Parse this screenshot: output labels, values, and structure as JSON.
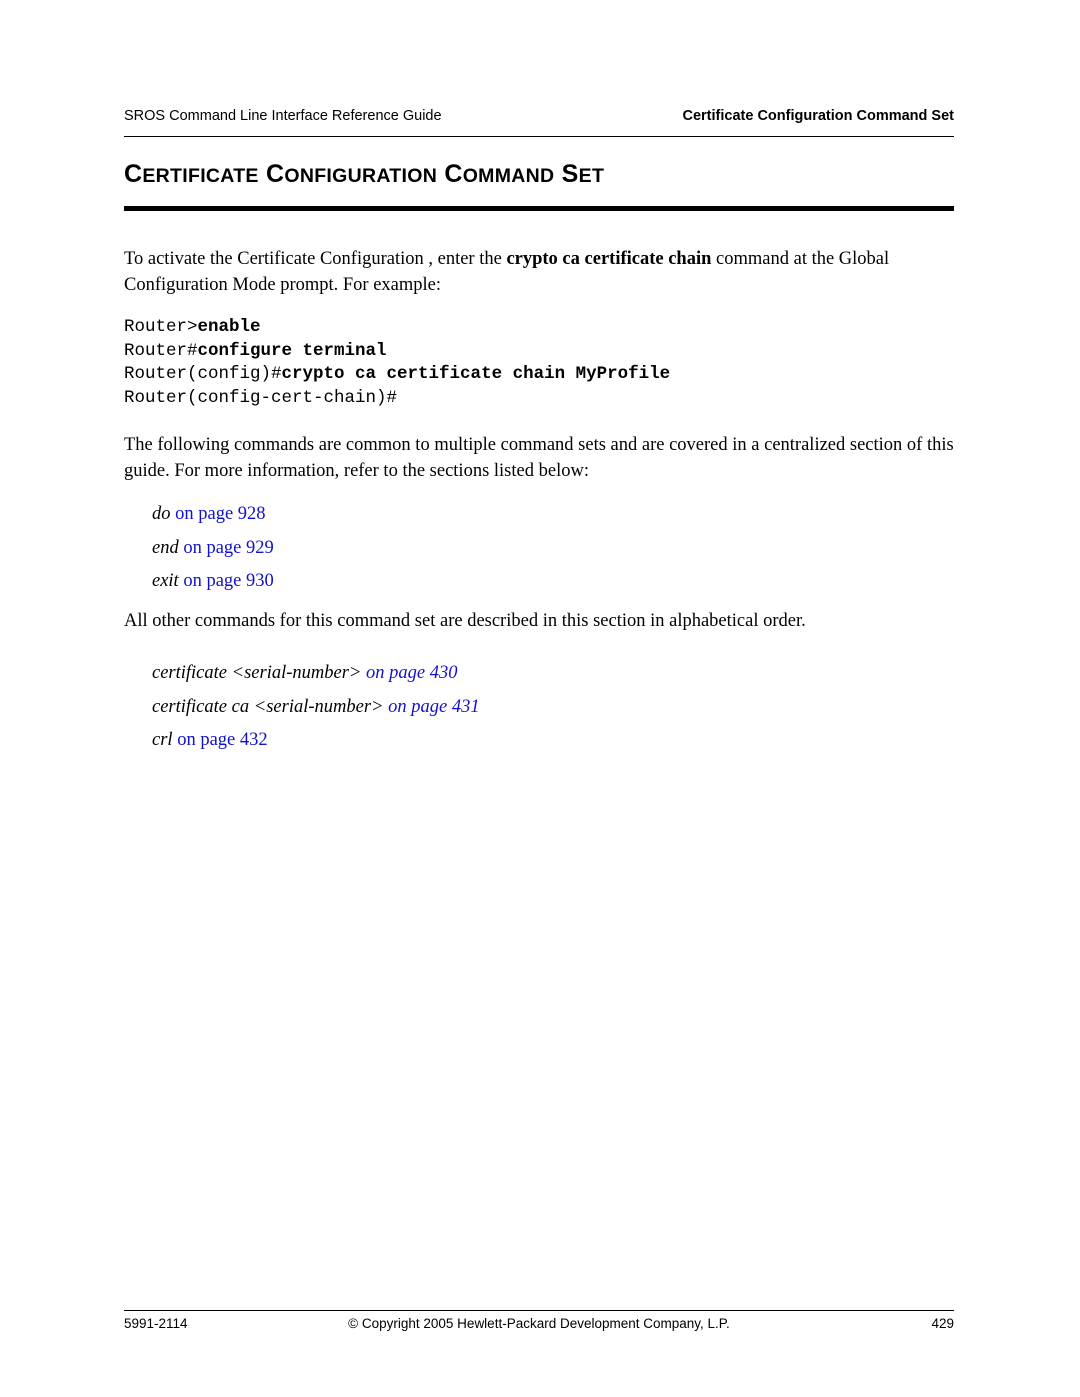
{
  "header": {
    "left": "SROS Command Line Interface Reference Guide",
    "right": "Certificate Configuration Command Set"
  },
  "title": {
    "first_cap": "C",
    "rest_1": "ERTIFICATE",
    "second_cap": "C",
    "rest_2": "ONFIGURATION",
    "third_cap": "C",
    "rest_3": "OMMAND",
    "fourth_cap": "S",
    "rest_4": "ET",
    "plain": "CERTIFICATE CONFIGURATION COMMAND SET"
  },
  "paragraphs": {
    "intro_part1": "To activate the Certificate Configuration , enter the ",
    "intro_bold": "crypto ca certificate chain",
    "intro_part2": " command at the Global Configuration Mode prompt. For example:",
    "common_text": "The following commands are common to multiple command sets and are covered in a centralized section of this guide. For more information, refer to the sections listed below:",
    "alpha_text": "All other commands for this command set are described in this section in alphabetical order."
  },
  "code": {
    "line1_prompt": "Router>",
    "line1_cmd": "enable",
    "line2_prompt": "Router#",
    "line2_cmd": "configure terminal",
    "line3_prompt": "Router(config)#",
    "line3_cmd": "crypto ca certificate chain MyProfile",
    "line4_prompt": "Router(config-cert-chain)#"
  },
  "xrefs_common": [
    {
      "cmd": "do",
      "link": "on page 928"
    },
    {
      "cmd": "end",
      "link": "on page 929"
    },
    {
      "cmd": "exit",
      "link": "on page 930"
    }
  ],
  "xrefs_other": [
    {
      "cmd": "certificate ",
      "arg": "<serial-number>",
      "link": " on page 430"
    },
    {
      "cmd": "certificate ca ",
      "arg": "<serial-number>",
      "link": " on page 431"
    },
    {
      "cmd": "crl ",
      "arg": "",
      "link": "on page 432"
    }
  ],
  "footer": {
    "left": "5991-2114",
    "center": "© Copyright 2005 Hewlett-Packard Development Company, L.P.",
    "right": "429"
  },
  "colors": {
    "link": "#1111cc",
    "text": "#000000",
    "background": "#ffffff"
  }
}
